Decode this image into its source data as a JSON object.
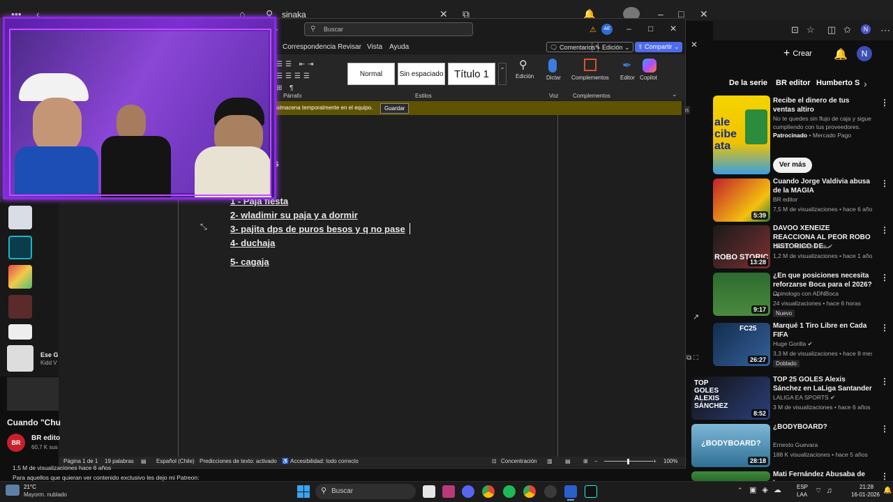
{
  "browser": {
    "address": "sinaka"
  },
  "youtube": {
    "create_label": "Crear",
    "avatar_letter": "N",
    "chips": [
      "De la serie",
      "BR editor",
      "Humberto S"
    ],
    "ad": {
      "title": "Recibe el dinero de tus ventas altiro",
      "desc": "No te quedes sin flujo de caja y sigue cumpliendo con tus proveedores.",
      "sponsor": "Patrocinado • Mercado Pago",
      "button": "Ver más"
    },
    "videos": [
      {
        "title": "Cuando Jorge Valdivia abusa de la MAGIA",
        "channel": "BR editor",
        "meta": "7,5 M de visualizaciones • hace 6 años",
        "duration": "5:39",
        "badge": ""
      },
      {
        "title": "DAVOO XENEIZE REACCIONA AL PEOR ROBO HISTORICO DE...",
        "channel": "Davoo Xeneize Plus",
        "meta": "1,2 M de visualizaciones • hace 1 año",
        "duration": "13:28",
        "badge": ""
      },
      {
        "title": "¿En que posiciones necesita reforzarse Boca para el 2026? ...",
        "channel": "Opinologo con ADNBoca",
        "meta": "24 visualizaciones • hace 6 horas",
        "duration": "9:17",
        "badge": "Nuevo"
      },
      {
        "title": "Marqué 1 Tiro Libre en Cada FIFA",
        "channel": "Huge Gorilla",
        "meta": "3,3 M de visualizaciones • hace 8 meses",
        "duration": "26:27",
        "badge": "Doblado"
      },
      {
        "title": "TOP 25 GOLES Alexis Sánchez en LaLiga Santander",
        "channel": "LALIGA EA SPORTS",
        "meta": "3 M de visualizaciones • hace 6 años",
        "duration": "8:52",
        "badge": ""
      },
      {
        "title": "¿BODYBOARD?",
        "channel": "Ernesto Guevara",
        "meta": "188 K visualizaciones • hace 5 años",
        "duration": "28:18",
        "badge": ""
      },
      {
        "title": "Mati Fernández Abusaba de la",
        "channel": "",
        "meta": "",
        "duration": "",
        "badge": ""
      }
    ],
    "thumb_texts": {
      "top_goles": "TOP GOLES ALEXIS SÁNCHEZ",
      "bodyboard": "¿BODYBOARD?",
      "fc25": "FC25",
      "robo": "ROBO STORIC"
    },
    "left": {
      "mini_title": "Ese G",
      "mini_sub": "Kidd V",
      "video_title": "Cuando \"Chu",
      "channel": "BR edito",
      "subs": "60,7 K sus",
      "views": "1,5 M de visualizaciones  hace 6 años",
      "desc": "Para aquellos que quieran ver contenido exclusivo les dejo mi Patreon:",
      "br_badge": "BR"
    }
  },
  "word": {
    "search_placeholder": "Buscar",
    "user_initials": "AE",
    "tabs": [
      "Correspondencia",
      "Revisar",
      "Vista",
      "Ayuda"
    ],
    "comments_btn": "Comentarios",
    "edit_btn": "Edición",
    "share_btn": "Compartir",
    "styles": [
      "Normal",
      "Sin espaciado",
      "Título 1"
    ],
    "groups": {
      "paragraph": "Párrafo",
      "styles": "Estilos",
      "voice": "Voz",
      "addins": "Complementos"
    },
    "ribbon_buttons": {
      "edit": "Edición",
      "dictate": "Dictar",
      "addins": "Complementos",
      "editor": "Editor",
      "copilot": "Copilot"
    },
    "infobar_text": "almacena temporalmente en el equipo.",
    "save_button": "Guardar",
    "doc_lines": [
      "1 - Paja fiesta",
      "2- wladimir su paja y a dormir",
      "3- pajita dps de puros besos y q no pase",
      "4- duchaja",
      "5- cagaja"
    ],
    "doc_partial": "s",
    "status": {
      "page": "Página 1 de 1",
      "words": "19 palabras",
      "language": "Español (Chile)",
      "predictions": "Predicciones de texto: activado",
      "accessibility": "Accesibilidad: todo correcto",
      "focus": "Concentración",
      "zoom": "100%"
    }
  },
  "taskbar": {
    "weather_temp": "21°C",
    "weather_desc": "Mayorm. nublado",
    "search": "Buscar",
    "lang1": "ESP",
    "lang2": "LAA",
    "time": "21:28",
    "date": "16-01-2026"
  },
  "colors": {
    "share_blue": "#4f6bed",
    "infobar": "#605300",
    "webcam_border": "#8b2be2"
  }
}
